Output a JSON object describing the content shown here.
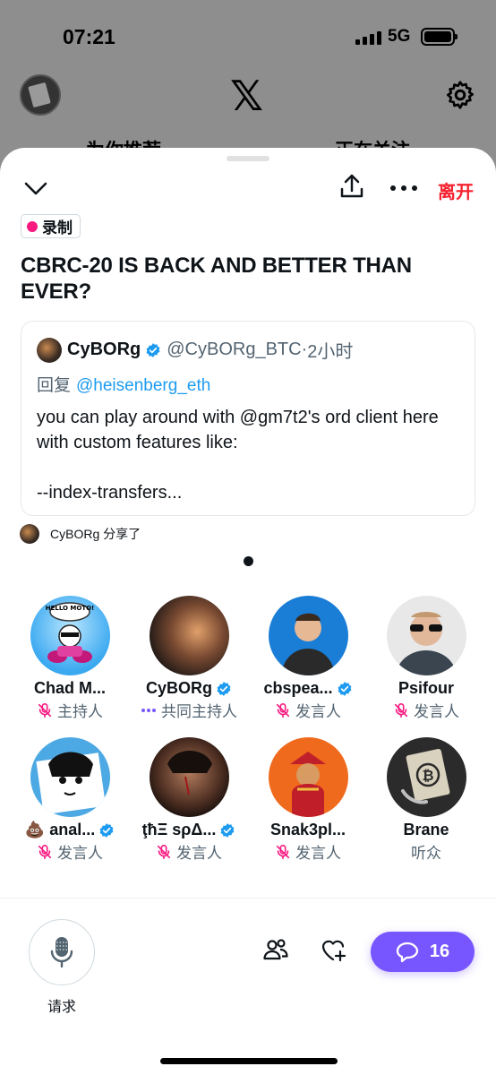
{
  "status_bar": {
    "time": "07:21",
    "network": "5G"
  },
  "background": {
    "tab_left": "为你推荐",
    "tab_right": "正在关注"
  },
  "space": {
    "leave_label": "离开",
    "recording_label": "录制",
    "title": "CBRC-20 IS BACK AND BETTER THAN EVER?"
  },
  "pinned_post": {
    "name": "CyBORg",
    "handle": "@CyBORg_BTC",
    "separator": "·",
    "time": "2小时",
    "reply_prefix": "回复",
    "reply_to": "@heisenberg_eth",
    "body": "you can play around with @gm7t2's ord client here with custom features like:\n\n--index-transfers..."
  },
  "shared_by": "CyBORg 分享了",
  "participants": [
    {
      "name": "Chad M...",
      "role": "主持人",
      "verified": false,
      "role_icon": "mic-muted-icon"
    },
    {
      "name": "CyBORg",
      "role": "共同主持人",
      "verified": true,
      "role_icon": "speaking-dots-icon"
    },
    {
      "name": "cbspea...",
      "role": "发言人",
      "verified": true,
      "role_icon": "mic-muted-icon"
    },
    {
      "name": "Psifour",
      "role": "发言人",
      "verified": false,
      "role_icon": "mic-muted-icon"
    },
    {
      "name": "💩 anal...",
      "role": "发言人",
      "verified": true,
      "role_icon": "mic-muted-icon"
    },
    {
      "name": "ţħΞ sρΔ...",
      "role": "发言人",
      "verified": true,
      "role_icon": "mic-muted-icon"
    },
    {
      "name": "Snak3pl...",
      "role": "发言人",
      "verified": false,
      "role_icon": "mic-muted-icon"
    },
    {
      "name": "Brane",
      "role": "听众",
      "verified": false,
      "role_icon": ""
    }
  ],
  "avatar_texts": {
    "chad": "HELLO MOTO!"
  },
  "bottom_bar": {
    "request_label": "请求",
    "comment_count": "16"
  },
  "colors": {
    "accent": "#7856ff",
    "leave": "#f4212e",
    "verified": "#1d9bf0",
    "recording_dot": "#f91880",
    "muted": "#f91880"
  }
}
